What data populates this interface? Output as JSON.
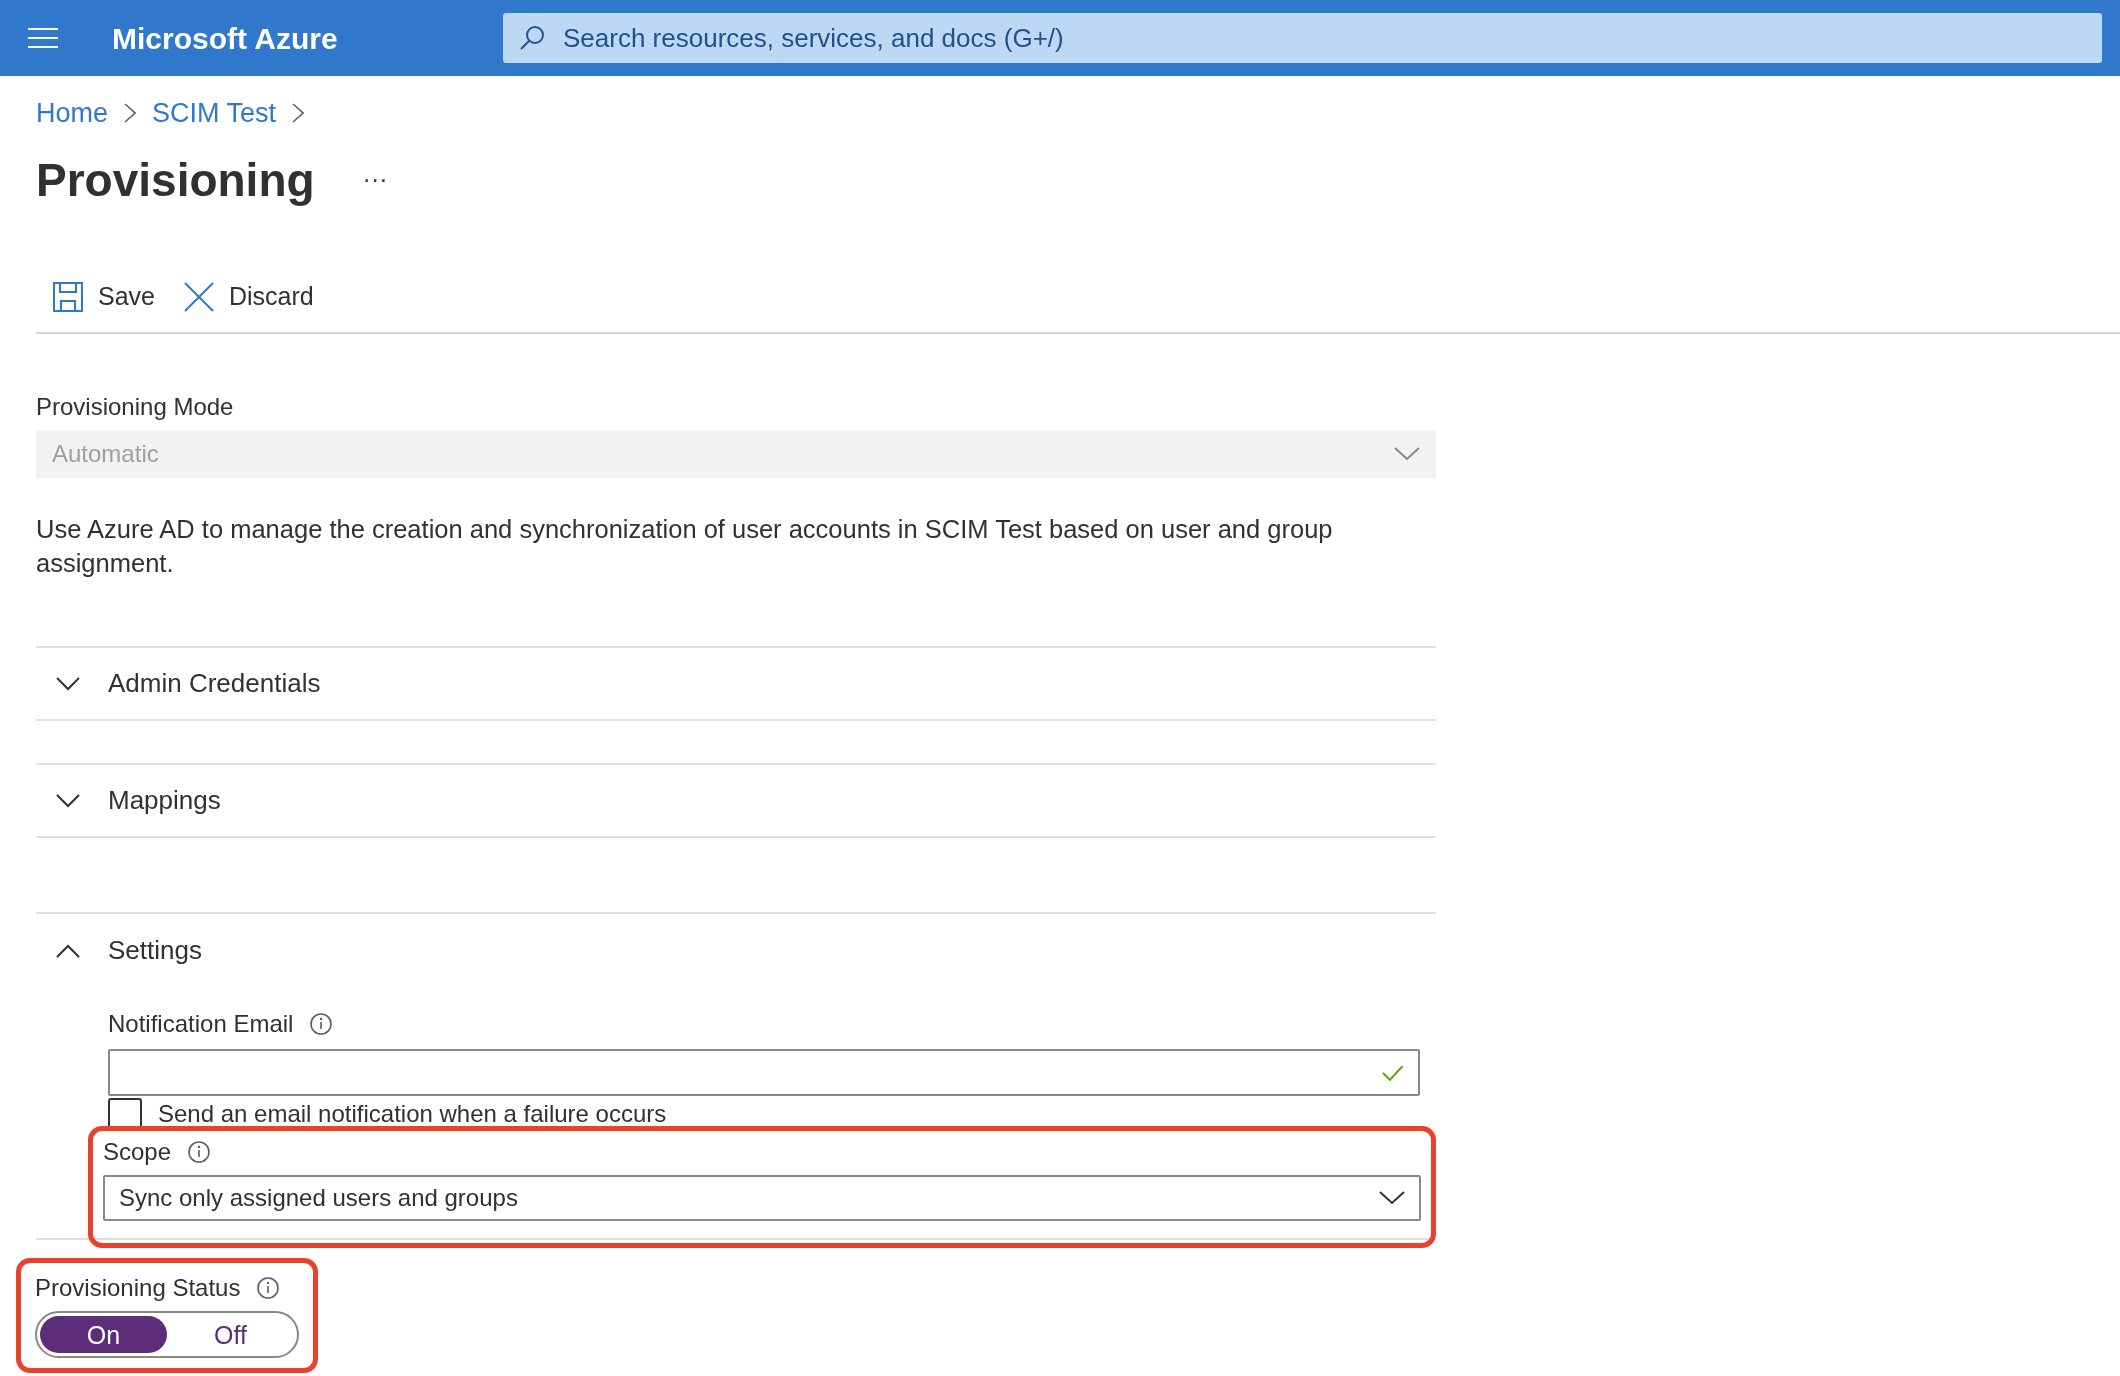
{
  "topbar": {
    "brand": "Microsoft Azure",
    "search": {
      "placeholder": "Search resources, services, and docs (G+/)"
    }
  },
  "breadcrumb": [
    "Home",
    "SCIM Test"
  ],
  "page": {
    "title": "Provisioning",
    "more": "···"
  },
  "toolbar": [
    {
      "kind": "save",
      "label": "Save"
    },
    {
      "kind": "discard",
      "label": "Discard"
    }
  ],
  "provisioning_mode": {
    "label": "Provisioning Mode",
    "value": "Automatic",
    "disabled": true
  },
  "description": "Use Azure AD to manage the creation and synchronization of user accounts in SCIM Test based on user and group assignment.",
  "sections": [
    {
      "title": "Admin Credentials",
      "expanded": false
    },
    {
      "title": "Mappings",
      "expanded": false
    },
    {
      "title": "Settings",
      "expanded": true
    }
  ],
  "settings": {
    "notification_email": {
      "label": "Notification Email",
      "valid": true
    },
    "failure_email": {
      "label": "Send an email notification when a failure occurs",
      "checked": false
    },
    "scope": {
      "label": "Scope",
      "value": "Sync only assigned users and groups",
      "highlighted": true
    }
  },
  "provisioning_status": {
    "label": "Provisioning Status",
    "highlighted": true,
    "options": [
      {
        "label": "On",
        "selected": true
      },
      {
        "label": "Off",
        "selected": false
      }
    ]
  }
}
